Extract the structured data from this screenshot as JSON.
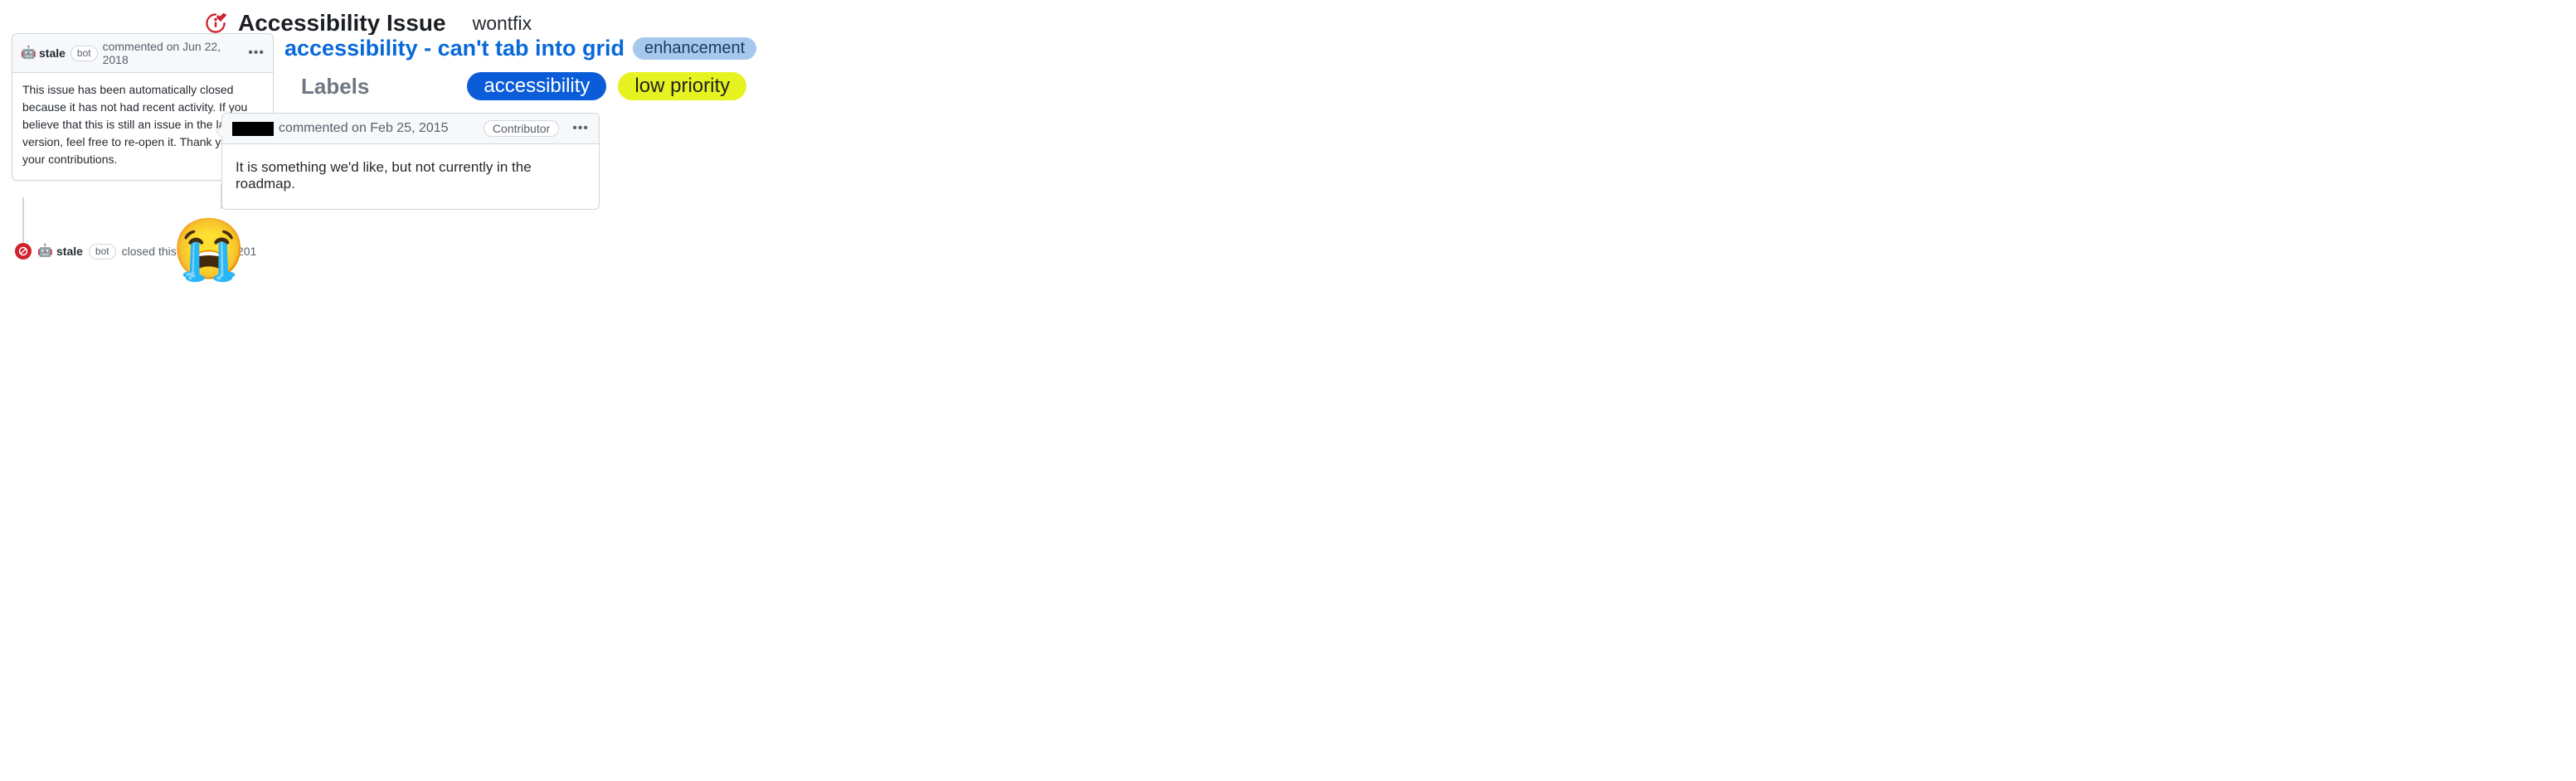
{
  "title": {
    "issue_title": "Accessibility Issue",
    "tag": "wontfix"
  },
  "left_comment": {
    "author": "stale",
    "bot_label": "bot",
    "meta": "commented on Jun 22, 2018",
    "body": "This issue has been automatically closed because it has not had recent activity. If you believe that this is still an issue in the latest version, feel free to re-open it. Thank you for your contributions."
  },
  "closed_event": {
    "author": "stale",
    "bot_label": "bot",
    "text": "closed this on Jun 22, 201"
  },
  "linked_issue": {
    "title": "accessibility - can't tab into grid",
    "badge": "enhancement"
  },
  "labels": {
    "heading": "Labels",
    "items": [
      {
        "text": "accessibility",
        "color": "blue"
      },
      {
        "text": "low priority",
        "color": "yellow"
      }
    ]
  },
  "right_comment": {
    "meta": "commented on Feb 25, 2015",
    "role_badge": "Contributor",
    "body": "It is something we'd like, but not currently in the roadmap."
  },
  "icons": {
    "cry": "😭",
    "robot": "🤖"
  }
}
